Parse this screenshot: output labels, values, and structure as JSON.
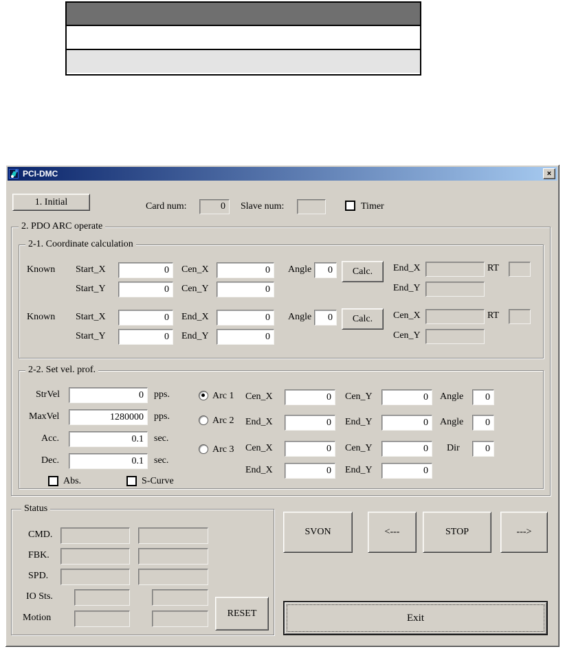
{
  "window": {
    "title": "PCI-DMC",
    "close_glyph": "×"
  },
  "header": {
    "initial_button": "1. Initial",
    "card_num_label": "Card num:",
    "card_num_value": "0",
    "slave_num_label": "Slave num:",
    "slave_num_value": "",
    "timer_label": "Timer"
  },
  "pdo": {
    "title": "2. PDO ARC operate",
    "coord": {
      "title": "2-1. Coordinate calculation",
      "b1": {
        "known": "Known",
        "r1a_label": "Start_X",
        "r1a_value": "0",
        "r1b_label": "Cen_X",
        "r1b_value": "0",
        "angle_label": "Angle",
        "angle_value": "0",
        "calc_button": "Calc.",
        "r1c_label": "End_X",
        "r1c_value": "",
        "rt_label": "RT",
        "rt_value": "",
        "r2a_label": "Start_Y",
        "r2a_value": "0",
        "r2b_label": "Cen_Y",
        "r2b_value": "0",
        "r2c_label": "End_Y",
        "r2c_value": ""
      },
      "b2": {
        "known": "Known",
        "r1a_label": "Start_X",
        "r1a_value": "0",
        "r1b_label": "End_X",
        "r1b_value": "0",
        "angle_label": "Angle",
        "angle_value": "0",
        "calc_button": "Calc.",
        "r1c_label": "Cen_X",
        "r1c_value": "",
        "rt_label": "RT",
        "rt_value": "",
        "r2a_label": "Start_Y",
        "r2a_value": "0",
        "r2b_label": "End_Y",
        "r2b_value": "0",
        "r2c_label": "Cen_Y",
        "r2c_value": ""
      }
    },
    "vel": {
      "title": "2-2. Set vel. prof.",
      "fields": [
        {
          "label": "StrVel",
          "value": "0",
          "unit": "pps."
        },
        {
          "label": "MaxVel",
          "value": "1280000",
          "unit": "pps."
        },
        {
          "label": "Acc.",
          "value": "0.1",
          "unit": "sec."
        },
        {
          "label": "Dec.",
          "value": "0.1",
          "unit": "sec."
        }
      ],
      "abs_label": "Abs.",
      "scurve_label": "S-Curve",
      "arc1": {
        "name": "Arc 1",
        "selected": true,
        "c1_label": "Cen_X",
        "c1_value": "0",
        "c2_label": "Cen_Y",
        "c2_value": "0",
        "c3_label": "Angle",
        "c3_value": "0"
      },
      "arc2": {
        "name": "Arc 2",
        "selected": false,
        "c1_label": "End_X",
        "c1_value": "0",
        "c2_label": "End_Y",
        "c2_value": "0",
        "c3_label": "Angle",
        "c3_value": "0"
      },
      "arc3": {
        "name": "Arc 3",
        "selected": false,
        "c1_label": "Cen_X",
        "c1_value": "0",
        "c2_label": "Cen_Y",
        "c2_value": "0",
        "c3_label": "Dir",
        "c3_value": "0"
      },
      "arc3b": {
        "c1_label": "End_X",
        "c1_value": "0",
        "c2_label": "End_Y",
        "c2_value": "0"
      }
    }
  },
  "status": {
    "title": "Status",
    "rows": [
      {
        "label": "CMD.",
        "v1": "",
        "v2": ""
      },
      {
        "label": "FBK.",
        "v1": "",
        "v2": ""
      },
      {
        "label": "SPD.",
        "v1": "",
        "v2": ""
      },
      {
        "label": "IO Sts.",
        "v1": "",
        "v2": ""
      },
      {
        "label": "Motion",
        "v1": "",
        "v2": ""
      }
    ],
    "reset_button": "RESET"
  },
  "actions": {
    "svon": "SVON",
    "jog_left": "<---",
    "stop": "STOP",
    "jog_right": "--->",
    "exit": "Exit"
  },
  "colors": {
    "window_face": "#d4d0c8",
    "titlebar_gradient_left": "#0a246a",
    "titlebar_gradient_right": "#a6caf0",
    "table_header_gray": "#6f6f6f",
    "table_light_gray": "#e4e4e4"
  }
}
